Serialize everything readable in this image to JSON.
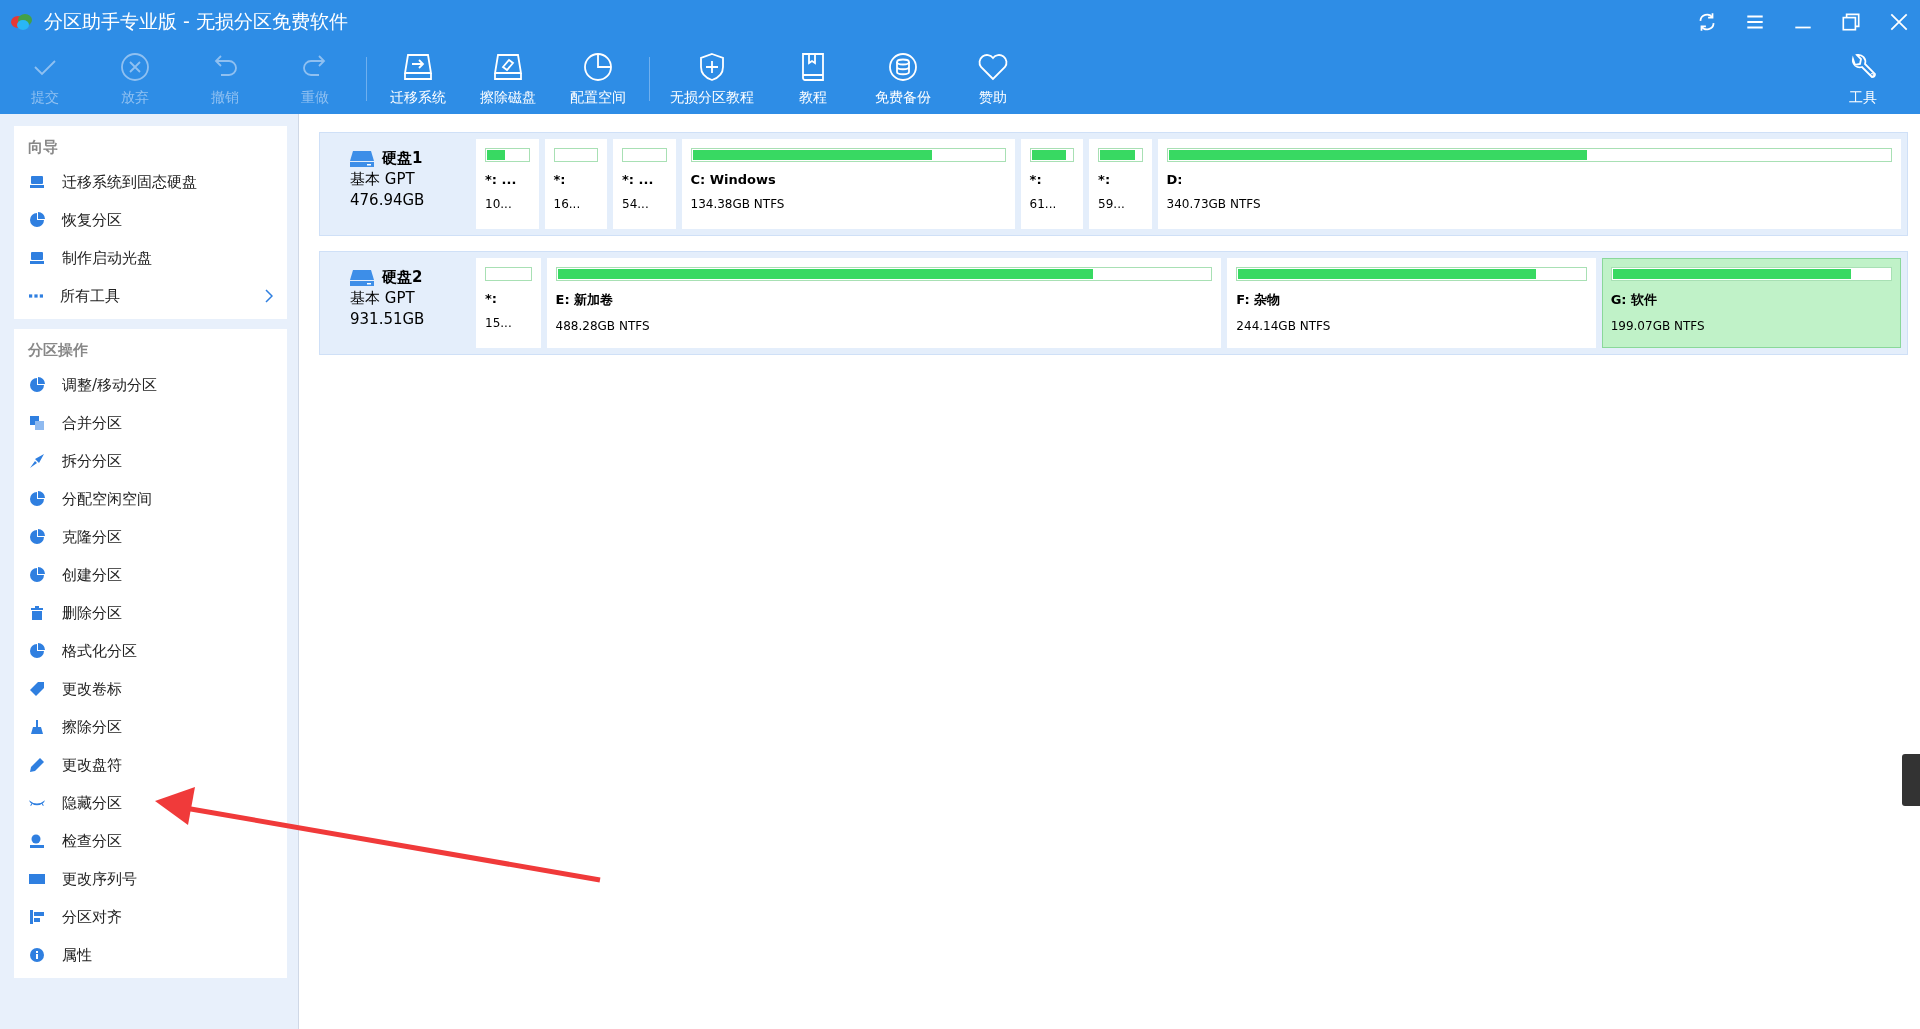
{
  "window": {
    "title": "分区助手专业版 - 无损分区免费软件"
  },
  "toolbar": [
    {
      "label": "提交",
      "disabled": true
    },
    {
      "label": "放弃",
      "disabled": true
    },
    {
      "label": "撤销",
      "disabled": true
    },
    {
      "label": "重做",
      "disabled": true
    },
    {
      "label": "迁移系统",
      "disabled": false
    },
    {
      "label": "擦除磁盘",
      "disabled": false
    },
    {
      "label": "配置空间",
      "disabled": false
    },
    {
      "label": "无损分区教程",
      "disabled": false
    },
    {
      "label": "教程",
      "disabled": false
    },
    {
      "label": "免费备份",
      "disabled": false
    },
    {
      "label": "赞助",
      "disabled": false
    }
  ],
  "tools_button": {
    "label": "工具"
  },
  "sidebar": {
    "sections": [
      {
        "title": "向导",
        "items": [
          {
            "label": "迁移系统到固态硬盘"
          },
          {
            "label": "恢复分区"
          },
          {
            "label": "制作启动光盘"
          },
          {
            "label": "所有工具",
            "expandable": true
          }
        ]
      },
      {
        "title": "分区操作",
        "items": [
          {
            "label": "调整/移动分区"
          },
          {
            "label": "合并分区"
          },
          {
            "label": "拆分分区"
          },
          {
            "label": "分配空闲空间"
          },
          {
            "label": "克隆分区"
          },
          {
            "label": "创建分区"
          },
          {
            "label": "删除分区"
          },
          {
            "label": "格式化分区"
          },
          {
            "label": "更改卷标"
          },
          {
            "label": "擦除分区"
          },
          {
            "label": "更改盘符"
          },
          {
            "label": "隐藏分区"
          },
          {
            "label": "检查分区"
          },
          {
            "label": "更改序列号"
          },
          {
            "label": "分区对齐"
          },
          {
            "label": "属性"
          }
        ]
      }
    ]
  },
  "disks": [
    {
      "name": "硬盘1",
      "type": "基本 GPT",
      "size": "476.94GB",
      "partitions": [
        {
          "name": "*: ...",
          "info": "10...",
          "level": 0.45,
          "selected": false
        },
        {
          "name": "*:",
          "info": "16...",
          "selected": false
        },
        {
          "name": "*: ...",
          "info": "54...",
          "selected": false
        },
        {
          "name": "C: Windows",
          "info": "134.38GB NTFS",
          "level": 0.77,
          "selected": false
        },
        {
          "name": "*:",
          "info": "61...",
          "level": 0.85,
          "selected": false
        },
        {
          "name": "*:",
          "info": "59...",
          "level": 0.85,
          "selected": false
        },
        {
          "name": "D:",
          "info": "340.73GB NTFS",
          "level": 0.58,
          "selected": false
        }
      ]
    },
    {
      "name": "硬盘2",
      "type": "基本 GPT",
      "size": "931.51GB",
      "partitions": [
        {
          "name": "*:",
          "info": "15...",
          "selected": false
        },
        {
          "name": "E: 新加卷",
          "info": "488.28GB NTFS",
          "level": 0.82,
          "selected": false
        },
        {
          "name": "F: 杂物",
          "info": "244.14GB NTFS",
          "level": 0.86,
          "selected": false
        },
        {
          "name": "G: 软件",
          "info": "199.07GB NTFS",
          "level": 0.86,
          "selected": true
        }
      ]
    }
  ]
}
